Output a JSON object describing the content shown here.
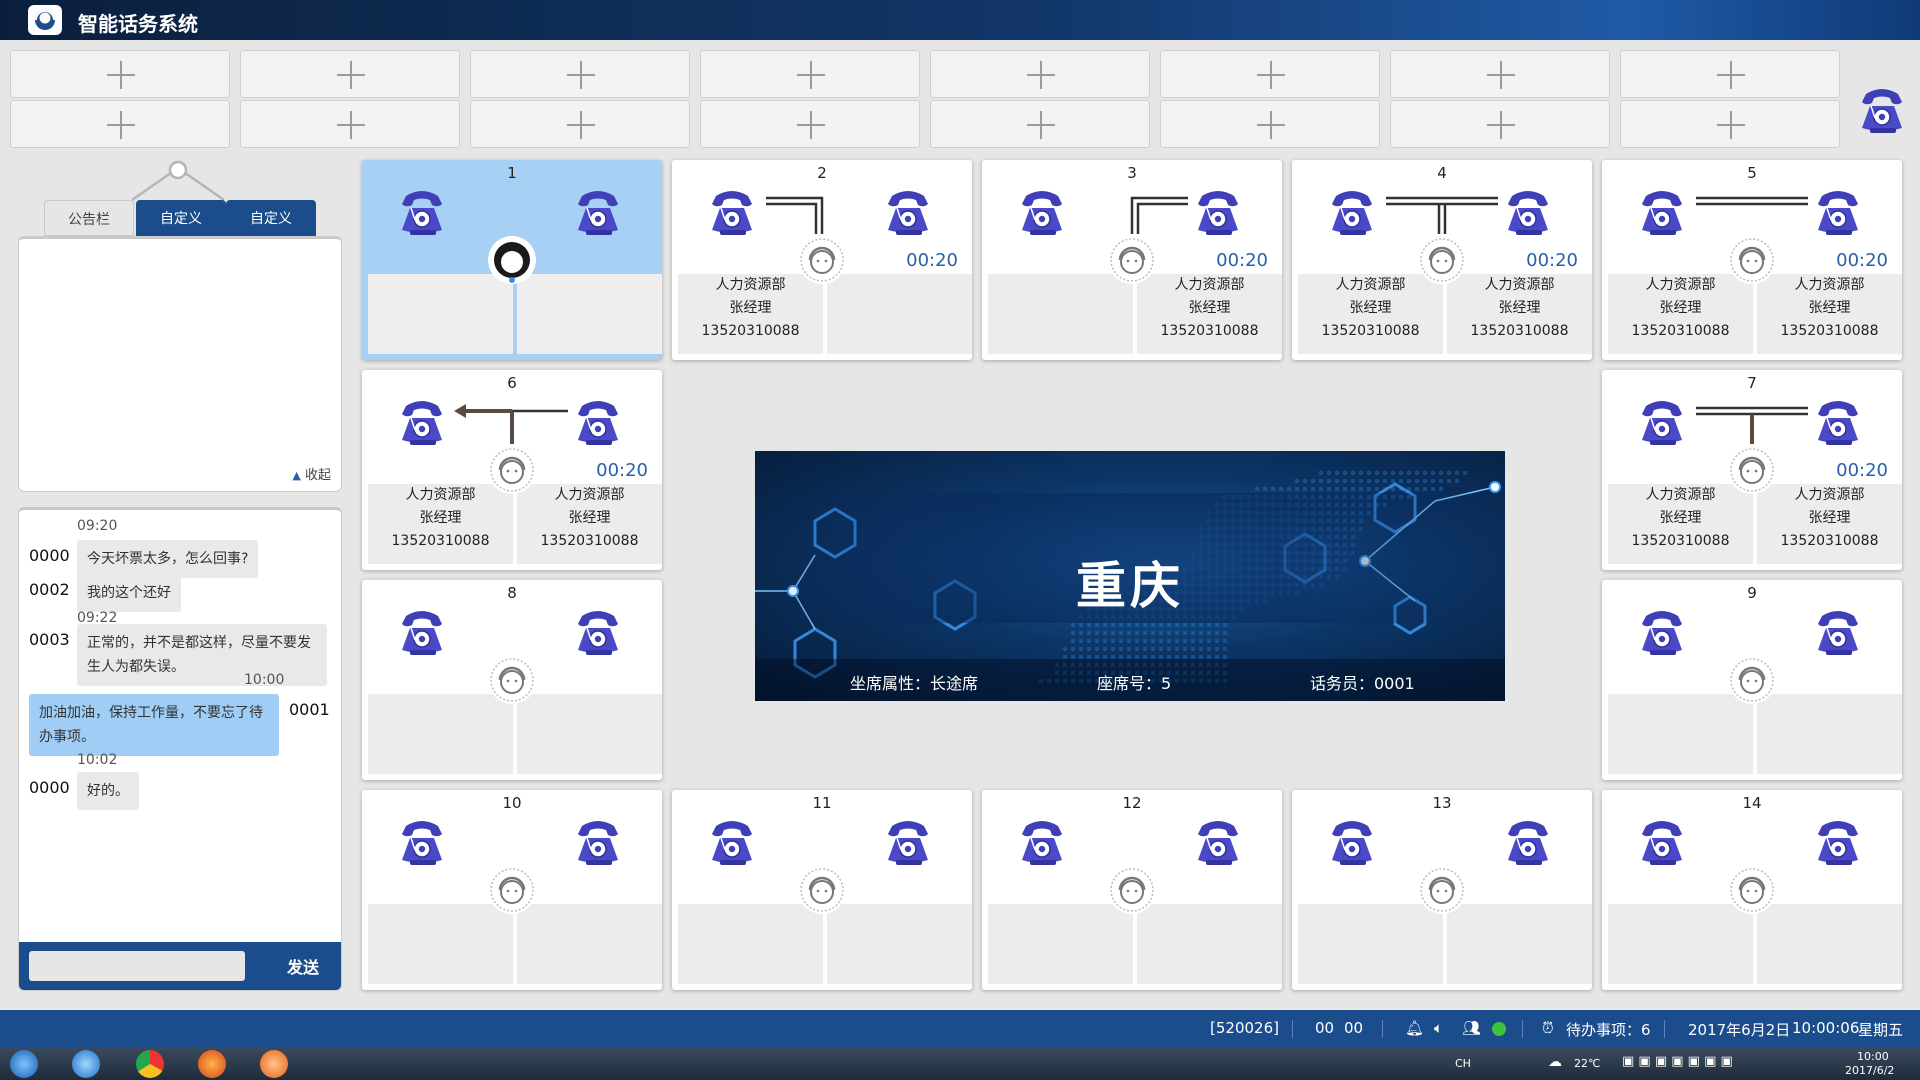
{
  "app": {
    "title": "智能话务系统"
  },
  "quick_slots": {
    "rows": 2,
    "cols": 8
  },
  "notice": {
    "tabs": [
      {
        "label": "公告栏",
        "active": false
      },
      {
        "label": "自定义",
        "active": true
      },
      {
        "label": "自定义",
        "active": true
      }
    ],
    "collapse_label": "收起"
  },
  "chat": {
    "messages": [
      {
        "time": "09:20",
        "user": "0000",
        "text": "今天坏票太多，怎么回事?",
        "self": false
      },
      {
        "time": "",
        "user": "0002",
        "text": "我的这个还好",
        "self": false
      },
      {
        "time": "09:22",
        "user": "0003",
        "text": "正常的，并不是都这样，尽量不要发生人为都失误。",
        "self": false
      },
      {
        "time": "10:00",
        "user": "0001",
        "text": "加油加油，保持工作量，不要忘了待办事项。",
        "self": true
      },
      {
        "time": "10:02",
        "user": "0000",
        "text": "好的。",
        "self": false
      }
    ],
    "input_value": "",
    "send_label": "发送"
  },
  "seats": [
    {
      "num": "1",
      "active": true,
      "timer": "",
      "link": "",
      "left": null,
      "right": null
    },
    {
      "num": "2",
      "active": false,
      "timer": "00:20",
      "link": "left",
      "left": {
        "dept": "人力资源部",
        "name": "张经理",
        "phone": "13520310088"
      },
      "right": null
    },
    {
      "num": "3",
      "active": false,
      "timer": "00:20",
      "link": "right",
      "left": null,
      "right": {
        "dept": "人力资源部",
        "name": "张经理",
        "phone": "13520310088"
      }
    },
    {
      "num": "4",
      "active": false,
      "timer": "00:20",
      "link": "both",
      "left": {
        "dept": "人力资源部",
        "name": "张经理",
        "phone": "13520310088"
      },
      "right": {
        "dept": "人力资源部",
        "name": "张经理",
        "phone": "13520310088"
      }
    },
    {
      "num": "5",
      "active": false,
      "timer": "00:20",
      "link": "direct",
      "left": {
        "dept": "人力资源部",
        "name": "张经理",
        "phone": "13520310088"
      },
      "right": {
        "dept": "人力资源部",
        "name": "张经理",
        "phone": "13520310088"
      }
    },
    {
      "num": "6",
      "active": false,
      "timer": "00:20",
      "link": "transfer",
      "left": {
        "dept": "人力资源部",
        "name": "张经理",
        "phone": "13520310088"
      },
      "right": {
        "dept": "人力资源部",
        "name": "张经理",
        "phone": "13520310088"
      }
    },
    {
      "num": "7",
      "active": false,
      "timer": "00:20",
      "link": "both-dark",
      "left": {
        "dept": "人力资源部",
        "name": "张经理",
        "phone": "13520310088"
      },
      "right": {
        "dept": "人力资源部",
        "name": "张经理",
        "phone": "13520310088"
      }
    },
    {
      "num": "8",
      "active": false,
      "timer": "",
      "link": "",
      "left": null,
      "right": null
    },
    {
      "num": "9",
      "active": false,
      "timer": "",
      "link": "",
      "left": null,
      "right": null
    },
    {
      "num": "10",
      "active": false,
      "timer": "",
      "link": "",
      "left": null,
      "right": null
    },
    {
      "num": "11",
      "active": false,
      "timer": "",
      "link": "",
      "left": null,
      "right": null
    },
    {
      "num": "12",
      "active": false,
      "timer": "",
      "link": "",
      "left": null,
      "right": null
    },
    {
      "num": "13",
      "active": false,
      "timer": "",
      "link": "",
      "left": null,
      "right": null
    },
    {
      "num": "14",
      "active": false,
      "timer": "",
      "link": "",
      "left": null,
      "right": null
    }
  ],
  "banner": {
    "city": "重庆",
    "seat_attr": "坐席属性：长途席",
    "seat_no": "座席号：5",
    "operator": "话务员：0001"
  },
  "status": {
    "code": "[520026]",
    "counter_a": "00",
    "counter_b": "00",
    "todo": "待办事项：6",
    "date": "2017年6月2日",
    "time": "10:00:06",
    "weekday": "星期五",
    "online_color": "#3cc43c"
  },
  "taskbar": {
    "lang": "CH",
    "temp": "22℃",
    "clock_time": "10:00",
    "clock_date": "2017/6/2"
  },
  "icons": {
    "phone": "telephone-icon",
    "agent": "operator-headset-icon",
    "plus": "plus-icon"
  },
  "colors": {
    "accent": "#1b4d8c",
    "active_seat": "#a8d0f5",
    "timer": "#2a60a8",
    "phone_blue": "#3f3fb8"
  }
}
